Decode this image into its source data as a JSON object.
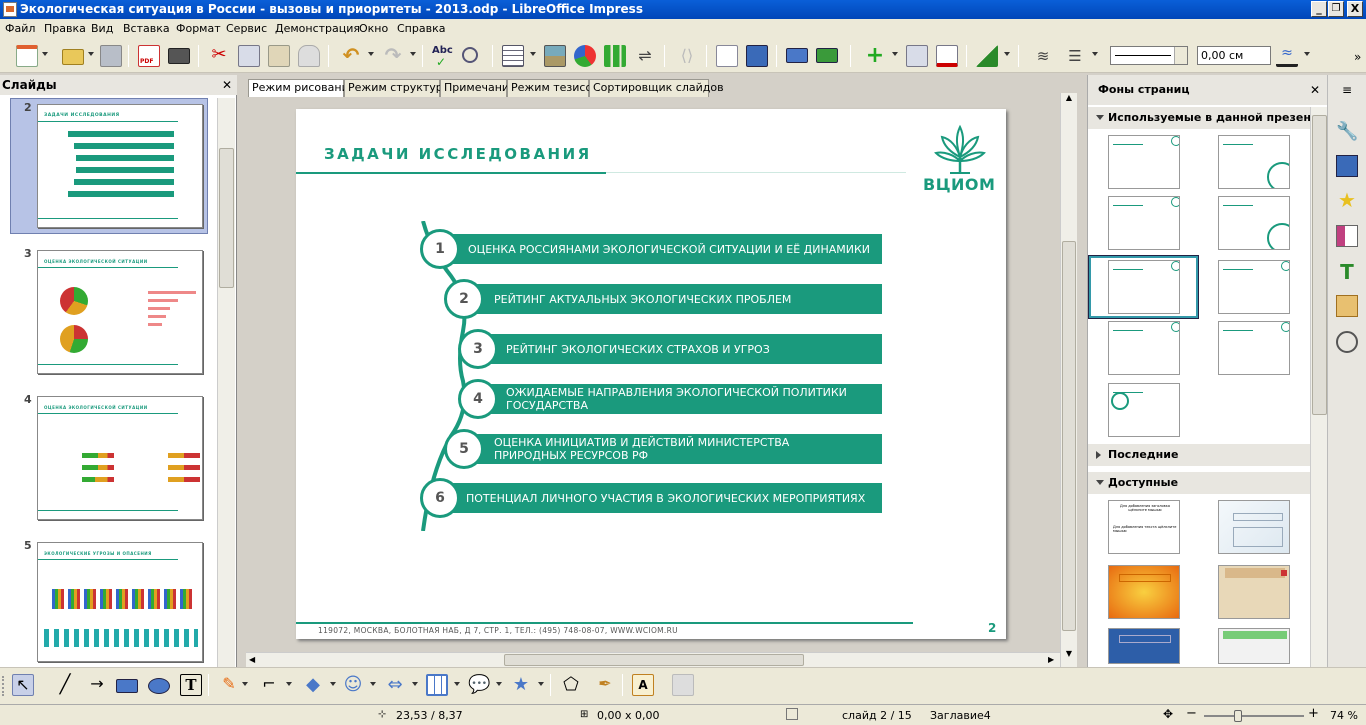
{
  "window": {
    "title": "Экологическая ситуация в России - вызовы и приоритеты - 2013.odp - LibreOffice Impress",
    "min": "_",
    "restore": "❐",
    "close": "X"
  },
  "menu": [
    "Файл",
    "Правка",
    "Вид",
    "Вставка",
    "Формат",
    "Сервис",
    "Демонстрация",
    "Окно",
    "Справка"
  ],
  "toolbar": {
    "line_width_value": "0,00 см"
  },
  "slides_panel": {
    "title": "Слайды",
    "close": "✕",
    "thumbnails": [
      {
        "number": "2",
        "title": "ЗАДАЧИ ИССЛЕДОВАНИЯ",
        "selected": true
      },
      {
        "number": "3",
        "title": "ОЦЕНКА ЭКОЛОГИЧЕСКОЙ СИТУАЦИИ",
        "selected": false
      },
      {
        "number": "4",
        "title": "ОЦЕНКА ЭКОЛОГИЧЕСКОЙ СИТУАЦИИ",
        "selected": false
      },
      {
        "number": "5",
        "title": "ЭКОЛОГИЧЕСКИЕ УГРОЗЫ И ОПАСЕНИЯ",
        "selected": false
      }
    ]
  },
  "view_tabs": [
    "Режим рисования",
    "Режим структуры",
    "Примечания",
    "Режим тезисов",
    "Сортировщик слайдов"
  ],
  "slide": {
    "title": "ЗАДАЧИ ИССЛЕДОВАНИЯ",
    "logo_text": "ВЦИОМ",
    "items": [
      {
        "num": "1",
        "text": "ОЦЕНКА РОССИЯНАМИ  ЭКОЛОГИЧЕСКОЙ СИТУАЦИИ И ЕЁ ДИНАМИКИ"
      },
      {
        "num": "2",
        "text": "РЕЙТИНГ АКТУАЛЬНЫХ ЭКОЛОГИЧЕСКИХ ПРОБЛЕМ"
      },
      {
        "num": "3",
        "text": "РЕЙТИНГ ЭКОЛОГИЧЕСКИХ СТРАХОВ И УГРОЗ"
      },
      {
        "num": "4",
        "text": "ОЖИДАЕМЫЕ НАПРАВЛЕНИЯ ЭКОЛОГИЧЕСКОЙ ПОЛИТИКИ ГОСУДАРСТВА"
      },
      {
        "num": "5",
        "text": "ОЦЕНКА ИНИЦИАТИВ  И ДЕЙСТВИЙ МИНИСТЕРСТВА ПРИРОДНЫХ РЕСУРСОВ РФ"
      },
      {
        "num": "6",
        "text": "ПОТЕНЦИАЛ ЛИЧНОГО УЧАСТИЯ В ЭКОЛОГИЧЕСКИХ МЕРОПРИЯТИЯХ"
      }
    ],
    "footer": "119072, МОСКВА, БОЛОТНАЯ НАБ, Д 7, СТР. 1, ТЕЛ.: (495) 748-08-07, WWW.WCIOM.RU",
    "page_number": "2"
  },
  "master_panel": {
    "title": "Фоны страниц",
    "close": "✕",
    "sections": [
      {
        "label": "Используемые в данной презентации",
        "expanded": true
      },
      {
        "label": "Последние",
        "expanded": false
      },
      {
        "label": "Доступные",
        "expanded": true
      }
    ],
    "available_labels": [
      "Для добавления заголовка щёлкните мышью",
      "Для добавления текста щёлкните мышью"
    ]
  },
  "statusbar": {
    "position": "23,53 / 8,37",
    "size": "0,00 x 0,00",
    "slide": "слайд 2 / 15",
    "master": "Заглавие4",
    "zoom": "74 %"
  },
  "colors": {
    "accent": "#1a9a7d",
    "titlebar": "#0a5fd8"
  }
}
